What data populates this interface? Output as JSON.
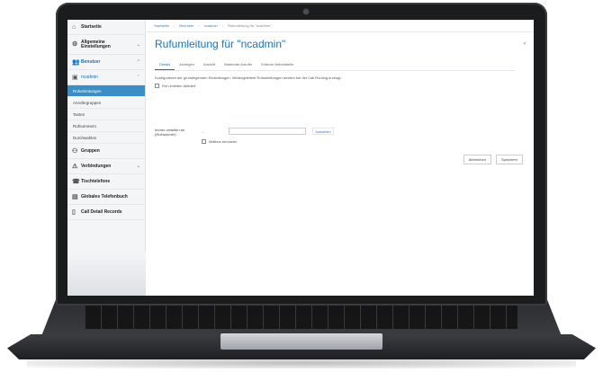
{
  "sidebar": {
    "start": "Startseite",
    "allg": "Allgemeine Einstellungen",
    "benutzer": "Benutzer",
    "ncadmin": "ncadmin",
    "subitems": [
      "Rufumleitungen",
      "Anrufergruppen",
      "Tasten",
      "Rufnummern",
      "Durchwahlen"
    ],
    "gruppen": "Gruppen",
    "verbindungen": "Verbindungen",
    "tischtelefone": "Tischtelefone",
    "telefonbuch": "Globales Telefonbuch",
    "cdr": "Call Detail Records"
  },
  "main": {
    "breadcrumbs": [
      "Startseite",
      "Benutzer",
      "ncadmin",
      "Rufumleitung für \"ncadmin\""
    ],
    "title": "Rufumleitung für \"ncadmin\"",
    "tabs": [
      "Details",
      "Anzeigen",
      "Ansicht",
      "Wartende Anrufer",
      "Externe Nebenstelle"
    ],
    "description": "Konfigurieren der grundlegenden Einstellungen. Weitergeleitete Rufumleitungen werden bei der Call Routing erzeugt.",
    "checkbox_label": "Ruf umleiten aktiviert",
    "form_label": "Immer umleiten an (Rufnummer)",
    "form_dash": "–",
    "form_btn": "Auswählen",
    "form_check": "Mailbox benutzen",
    "btn_cancel": "Abbrechen",
    "btn_save": "Speichern"
  }
}
